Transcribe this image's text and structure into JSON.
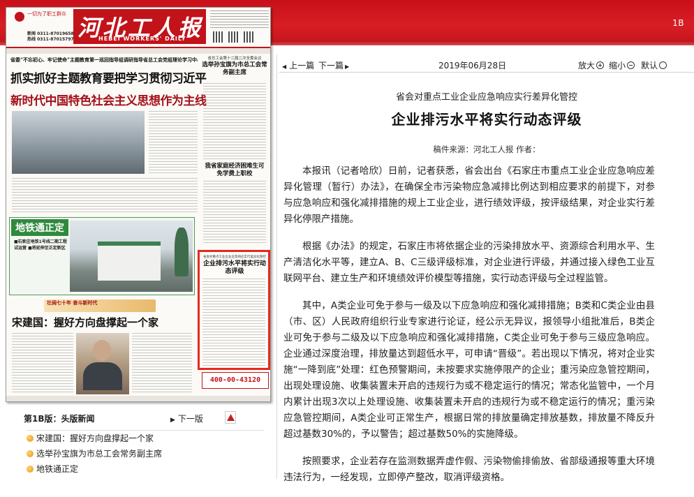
{
  "page": {
    "edition_code": "1B"
  },
  "newspaper": {
    "slogan": "一切为了职工群众",
    "title_cn": "河北工人报",
    "title_en": "HEBEI WORKERS' DAILY",
    "hotline_1": "新闻 0311-87019658",
    "hotline_2": "热线 0311-87015797",
    "lead_kicker": "省委“不忘初心、牢记使命”主题教育第一巡回指导组调研指导省总工会党组理论学习中心组主题教育学习交流会",
    "lead_headline_1": "抓实抓好主题教育要把学习贯彻习近平",
    "lead_headline_2": "新时代中国特色社会主义思想作为主线",
    "side_story_1_kicker": "省总工会第十二届二次全委会议",
    "side_story_1_head": "选举孙宝旗为市总工会常务副主席",
    "side_story_2_head": "我省家庭经济困难生可免学费上职校",
    "green_box_tag": "地铁通正定",
    "green_box_bullets": "■石家庄地铁1号线二期工程试运营 ■将延伸至正定新区",
    "feature_banner": "壮阔七十年 奋斗新时代",
    "feature_head": "宋建国：握好方向盘撑起一个家",
    "highlight_kicker": "省会对重点工业企业应急响应实行差异化管控",
    "highlight_head": "企业排污水平将实行动态评级",
    "ad_text": "400-00-43120"
  },
  "page_nav": {
    "label": "第1B版：头版新闻",
    "next_label": "下一版"
  },
  "article_list": [
    "宋建国：握好方向盘撑起一个家",
    "选举孙宝旗为市总工会常务副主席",
    "地铁通正定"
  ],
  "toolbar": {
    "prev_label": "上一篇",
    "next_label": "下一篇",
    "date": "2019年06月28日",
    "zoom_in_label": "放大",
    "zoom_out_label": "缩小",
    "default_label": "默认"
  },
  "article": {
    "subhead": "省会对重点工业企业应急响应实行差异化管控",
    "headline": "企业排污水平将实行动态评级",
    "source": "稿件来源：河北工人报 作者：",
    "paragraphs": [
      "本报讯（记者哈欣）日前，记者获悉，省会出台《石家庄市重点工业企业应急响应差异化管理（暂行）办法》，在确保全市污染物应急减排比例达到相应要求的前提下，对参与应急响应和强化减排措施的规上工业企业，进行绩效评级，按评级结果，对企业实行差异化停限产措施。",
      "根据《办法》的规定，石家庄市将依据企业的污染排放水平、资源综合利用水平、生产清洁化水平等，建立A、B、C三级评级标准，对企业进行评级，并通过接入绿色工业互联网平台、建立生产和环境绩效评价模型等措施，实行动态评级与全过程监管。",
      "其中，A类企业可免于参与一级及以下应急响应和强化减排措施；B类和C类企业由县（市、区）人民政府组织行业专家进行论证，经公示无异议，报领导小组批准后，B类企业可免于参与二级及以下应急响应和强化减排措施，C类企业可免于参与三级应急响应。企业通过深度治理，排放量达到超低水平，可申请“晋级”。若出现以下情况，将对企业实施“一降到底”处理：红色预警期间，未按要求实施停限产的企业；重污染应急管控期间，出现处理设施、收集装置未开启的违规行为或不稳定运行的情况；常态化监管中，一个月内累计出现3次以上处理设施、收集装置未开启的违规行为或不稳定运行的情况；重污染应急管控期间，A类企业可正常生产，根据日常的排放量确定排放基数，排放量不降反升超过基数30%的，予以警告；超过基数50%的实施降级。",
      "按照要求，企业若存在监测数据弄虚作假、污染物偷排偷放、省部级通报等重大环境违法行为，一经发现，立即停产整改，取消评级资格。"
    ]
  }
}
